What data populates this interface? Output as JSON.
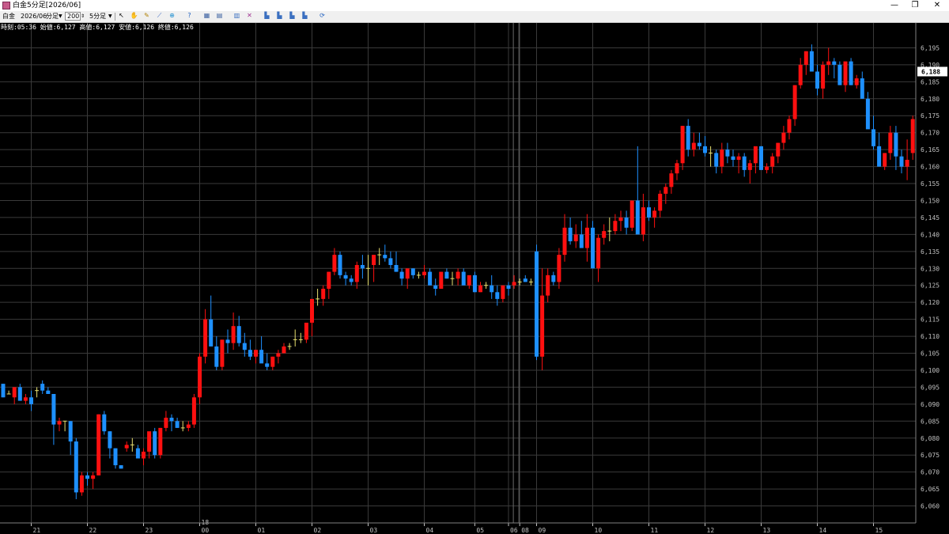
{
  "window": {
    "title": "白金5分足[2026/06]",
    "minimize": "—",
    "restore": "❐",
    "close": "✕"
  },
  "toolbar": {
    "symbol": "白金",
    "contract": "2026/06",
    "period_unit": "分足",
    "count": "200",
    "interval": "5分足",
    "icons": [
      "cursor-icon",
      "hand-icon",
      "pencil-icon",
      "ruler-icon",
      "zoom-icon",
      "help-icon",
      "table-icon",
      "grid-icon",
      "bar-chart-icon",
      "indicator-icon",
      "chart-a-icon",
      "chart-b-icon",
      "chart-c-icon",
      "chart-d-icon",
      "refresh-icon"
    ]
  },
  "info_line": "時刻:05:36 始値:6,127 高値:6,127 安値:6,126 終値:6,126",
  "colors": {
    "background": "#000000",
    "grid": "#3a3a3a",
    "up": "#ff1010",
    "down": "#1e90ff",
    "doji": "#e8e070",
    "axis_text": "#c0c0c0",
    "price_label_bg": "#ffffff"
  },
  "chart_data": {
    "type": "candlestick",
    "title": "白金5分足[2026/06]",
    "ylim": [
      6055,
      6200
    ],
    "y_ticks": [
      6060,
      6065,
      6070,
      6075,
      6080,
      6085,
      6090,
      6095,
      6100,
      6105,
      6110,
      6115,
      6120,
      6125,
      6130,
      6135,
      6140,
      6145,
      6150,
      6155,
      6160,
      6165,
      6170,
      6175,
      6180,
      6185,
      6190,
      6195
    ],
    "y_tick_labels": [
      "6,060",
      "6,065",
      "6,070",
      "6,075",
      "6,080",
      "6,085",
      "6,090",
      "6,095",
      "6,100",
      "6,105",
      "6,110",
      "6,115",
      "6,120",
      "6,125",
      "6,130",
      "6,135",
      "6,140",
      "6,145",
      "6,150",
      "6,155",
      "6,160",
      "6,165",
      "6,170",
      "6,175",
      "6,180",
      "6,185",
      "6,190",
      "6,195"
    ],
    "current_price": 6188,
    "current_price_label": "6,188",
    "x_labels": [
      {
        "index": 5,
        "label": "21"
      },
      {
        "index": 15,
        "label": "22"
      },
      {
        "index": 25,
        "label": "23"
      },
      {
        "index": 35,
        "label": "00"
      },
      {
        "index": 35,
        "label": "18",
        "row": "top"
      },
      {
        "index": 45,
        "label": "01"
      },
      {
        "index": 55,
        "label": "02"
      },
      {
        "index": 65,
        "label": "03"
      },
      {
        "index": 75,
        "label": "04"
      },
      {
        "index": 84,
        "label": "05"
      },
      {
        "index": 90,
        "label": "06"
      },
      {
        "index": 92,
        "label": "08"
      },
      {
        "index": 95,
        "label": "09"
      },
      {
        "index": 105,
        "label": "10"
      },
      {
        "index": 115,
        "label": "11"
      },
      {
        "index": 125,
        "label": "12"
      },
      {
        "index": 135,
        "label": "13"
      },
      {
        "index": 145,
        "label": "14"
      },
      {
        "index": 155,
        "label": "15"
      }
    ],
    "session_breaks": [
      91,
      92
    ],
    "candles": [
      [
        6096,
        6096,
        6092,
        6092
      ],
      [
        6093,
        6094,
        6093,
        6093
      ],
      [
        6092,
        6095,
        6090,
        6095
      ],
      [
        6095,
        6096,
        6091,
        6091
      ],
      [
        6091,
        6093,
        6090,
        6092
      ],
      [
        6092,
        6094,
        6088,
        6090
      ],
      [
        6094,
        6095,
        6092,
        6094
      ],
      [
        6096,
        6097,
        6093,
        6094
      ],
      [
        6094,
        6095,
        6093,
        6093
      ],
      [
        6093,
        6093,
        6078,
        6084
      ],
      [
        6084,
        6086,
        6082,
        6085
      ],
      [
        6085,
        6085,
        6082,
        6085
      ],
      [
        6085,
        6085,
        6075,
        6079
      ],
      [
        6079,
        6080,
        6062,
        6064
      ],
      [
        6064,
        6070,
        6063,
        6069
      ],
      [
        6069,
        6070,
        6066,
        6068
      ],
      [
        6068,
        6070,
        6065,
        6069
      ],
      [
        6069,
        6087,
        6069,
        6087
      ],
      [
        6087,
        6088,
        6081,
        6082
      ],
      [
        6082,
        6082,
        6074,
        6077
      ],
      [
        6077,
        6077,
        6071,
        6072
      ],
      [
        6072,
        6072,
        6071,
        6071
      ],
      [
        6077,
        6079,
        6076,
        6078
      ],
      [
        6078,
        6080,
        6076,
        6078
      ],
      [
        6077,
        6078,
        6074,
        6074
      ],
      [
        6074,
        6077,
        6072,
        6076
      ],
      [
        6076,
        6081,
        6074,
        6082
      ],
      [
        6082,
        6083,
        6074,
        6075
      ],
      [
        6075,
        6083,
        6074,
        6083
      ],
      [
        6083,
        6088,
        6082,
        6086
      ],
      [
        6086,
        6087,
        6082,
        6085
      ],
      [
        6085,
        6086,
        6083,
        6083
      ],
      [
        6083,
        6085,
        6082,
        6083
      ],
      [
        6083,
        6085,
        6082,
        6084
      ],
      [
        6084,
        6093,
        6083,
        6092
      ],
      [
        6092,
        6105,
        6090,
        6104
      ],
      [
        6104,
        6118,
        6102,
        6115
      ],
      [
        6115,
        6122,
        6110,
        6107
      ],
      [
        6107,
        6110,
        6100,
        6101
      ],
      [
        6101,
        6109,
        6100,
        6109
      ],
      [
        6109,
        6112,
        6105,
        6108
      ],
      [
        6108,
        6117,
        6106,
        6113
      ],
      [
        6113,
        6116,
        6107,
        6108
      ],
      [
        6108,
        6111,
        6104,
        6106
      ],
      [
        6106,
        6109,
        6103,
        6104
      ],
      [
        6104,
        6106,
        6102,
        6106
      ],
      [
        6106,
        6110,
        6103,
        6102
      ],
      [
        6102,
        6105,
        6100,
        6101
      ],
      [
        6101,
        6104,
        6100,
        6104
      ],
      [
        6104,
        6106,
        6102,
        6105
      ],
      [
        6105,
        6108,
        6105,
        6107
      ],
      [
        6107,
        6108,
        6106,
        6107
      ],
      [
        6109,
        6112,
        6107,
        6109
      ],
      [
        6109,
        6111,
        6108,
        6109
      ],
      [
        6109,
        6112,
        6108,
        6114
      ],
      [
        6114,
        6115,
        6110,
        6121
      ],
      [
        6121,
        6124,
        6119,
        6121
      ],
      [
        6121,
        6125,
        6119,
        6124
      ],
      [
        6124,
        6129,
        6121,
        6129
      ],
      [
        6129,
        6136,
        6128,
        6134
      ],
      [
        6134,
        6135,
        6127,
        6128
      ],
      [
        6128,
        6129,
        6125,
        6127
      ],
      [
        6127,
        6128,
        6125,
        6126
      ],
      [
        6126,
        6132,
        6124,
        6131
      ],
      [
        6131,
        6134,
        6127,
        6130
      ],
      [
        6130,
        6134,
        6125,
        6130
      ],
      [
        6131,
        6134,
        6126,
        6134
      ],
      [
        6134,
        6136,
        6131,
        6134
      ],
      [
        6134,
        6137,
        6132,
        6133
      ],
      [
        6133,
        6135,
        6130,
        6131
      ],
      [
        6131,
        6135,
        6129,
        6129
      ],
      [
        6129,
        6130,
        6125,
        6127
      ],
      [
        6127,
        6129,
        6124,
        6130
      ],
      [
        6130,
        6130,
        6127,
        6128
      ],
      [
        6128,
        6129,
        6127,
        6128
      ],
      [
        6128,
        6131,
        6127,
        6129
      ],
      [
        6129,
        6130,
        6127,
        6125
      ],
      [
        6125,
        6127,
        6122,
        6124
      ],
      [
        6124,
        6129,
        6124,
        6129
      ],
      [
        6129,
        6130,
        6127,
        6127
      ],
      [
        6127,
        6129,
        6125,
        6127
      ],
      [
        6127,
        6130,
        6125,
        6129
      ],
      [
        6129,
        6130,
        6127,
        6125
      ],
      [
        6125,
        6127,
        6124,
        6128
      ],
      [
        6128,
        6129,
        6123,
        6123
      ],
      [
        6123,
        6126,
        6123,
        6125
      ],
      [
        6125,
        6126,
        6124,
        6125
      ],
      [
        6125,
        6128,
        6121,
        6123
      ],
      [
        6123,
        6125,
        6119,
        6121
      ],
      [
        6121,
        6124,
        6120,
        6125
      ],
      [
        6125,
        6126,
        6122,
        6124
      ],
      [
        6125,
        6128,
        6124,
        6126
      ],
      [
        6126,
        6127,
        6125,
        6126
      ],
      [
        6127,
        6128,
        6126,
        6126
      ],
      [
        6126,
        6127,
        6125,
        6126
      ],
      [
        6135,
        6137,
        6103,
        6104
      ],
      [
        6104,
        6130,
        6100,
        6122
      ],
      [
        6122,
        6130,
        6120,
        6128
      ],
      [
        6128,
        6129,
        6125,
        6126
      ],
      [
        6126,
        6136,
        6124,
        6134
      ],
      [
        6134,
        6146,
        6132,
        6142
      ],
      [
        6142,
        6145,
        6137,
        6138
      ],
      [
        6138,
        6143,
        6136,
        6140
      ],
      [
        6140,
        6144,
        6137,
        6136
      ],
      [
        6136,
        6146,
        6132,
        6142
      ],
      [
        6142,
        6144,
        6130,
        6130
      ],
      [
        6130,
        6140,
        6126,
        6139
      ],
      [
        6139,
        6143,
        6137,
        6141
      ],
      [
        6141,
        6145,
        6138,
        6141
      ],
      [
        6141,
        6146,
        6140,
        6144
      ],
      [
        6144,
        6147,
        6141,
        6145
      ],
      [
        6145,
        6147,
        6140,
        6142
      ],
      [
        6142,
        6150,
        6141,
        6150
      ],
      [
        6150,
        6166,
        6141,
        6140
      ],
      [
        6140,
        6152,
        6138,
        6148
      ],
      [
        6148,
        6150,
        6144,
        6145
      ],
      [
        6145,
        6148,
        6142,
        6147
      ],
      [
        6147,
        6153,
        6145,
        6152
      ],
      [
        6152,
        6155,
        6149,
        6154
      ],
      [
        6154,
        6159,
        6152,
        6158
      ],
      [
        6158,
        6162,
        6156,
        6161
      ],
      [
        6161,
        6172,
        6159,
        6172
      ],
      [
        6172,
        6174,
        6163,
        6165
      ],
      [
        6165,
        6170,
        6163,
        6167
      ],
      [
        6167,
        6170,
        6165,
        6166
      ],
      [
        6166,
        6169,
        6163,
        6164
      ],
      [
        6164,
        6166,
        6160,
        6164
      ],
      [
        6164,
        6165,
        6158,
        6160
      ],
      [
        6160,
        6167,
        6158,
        6165
      ],
      [
        6165,
        6167,
        6161,
        6163
      ],
      [
        6163,
        6165,
        6160,
        6162
      ],
      [
        6162,
        6164,
        6158,
        6163
      ],
      [
        6163,
        6164,
        6157,
        6159
      ],
      [
        6159,
        6162,
        6155,
        6161
      ],
      [
        6161,
        6164,
        6158,
        6166
      ],
      [
        6166,
        6166,
        6159,
        6159
      ],
      [
        6159,
        6161,
        6158,
        6160
      ],
      [
        6160,
        6164,
        6158,
        6163
      ],
      [
        6163,
        6167,
        6161,
        6167
      ],
      [
        6167,
        6172,
        6165,
        6170
      ],
      [
        6170,
        6175,
        6168,
        6174
      ],
      [
        6174,
        6184,
        6172,
        6184
      ],
      [
        6184,
        6192,
        6183,
        6190
      ],
      [
        6190,
        6194,
        6187,
        6194
      ],
      [
        6194,
        6196,
        6191,
        6188
      ],
      [
        6188,
        6190,
        6181,
        6183
      ],
      [
        6183,
        6191,
        6180,
        6190
      ],
      [
        6190,
        6195,
        6187,
        6191
      ],
      [
        6191,
        6192,
        6186,
        6190
      ],
      [
        6190,
        6191,
        6186,
        6184
      ],
      [
        6184,
        6190,
        6182,
        6191
      ],
      [
        6191,
        6192,
        6184,
        6184
      ],
      [
        6184,
        6187,
        6183,
        6186
      ],
      [
        6186,
        6188,
        6180,
        6180
      ],
      [
        6180,
        6182,
        6172,
        6171
      ],
      [
        6171,
        6175,
        6165,
        6166
      ],
      [
        6166,
        6170,
        6160,
        6160
      ],
      [
        6160,
        6164,
        6159,
        6164
      ],
      [
        6164,
        6172,
        6162,
        6170
      ],
      [
        6170,
        6172,
        6159,
        6163
      ],
      [
        6163,
        6165,
        6158,
        6160
      ],
      [
        6160,
        6168,
        6156,
        6162
      ],
      [
        6164,
        6175,
        6162,
        6174
      ]
    ]
  }
}
